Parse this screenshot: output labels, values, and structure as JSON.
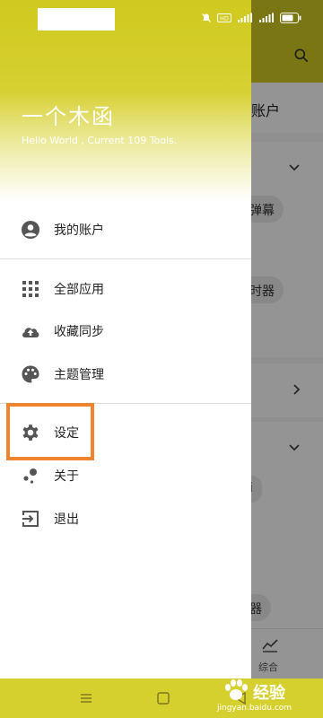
{
  "background_app": {
    "account_label": "账户",
    "chip_danmu": "弹幕",
    "chip_timer": "时器",
    "chip_lower1": "i",
    "chip_lower2": "器",
    "bottom_tab_label": "综合",
    "search_icon": "search-icon"
  },
  "drawer": {
    "title": "一个木函",
    "subtitle": "Hello World , Current 109 Tools.",
    "items": [
      {
        "label": "我的账户",
        "icon": "account-circle-icon"
      },
      {
        "label": "全部应用",
        "icon": "apps-grid-icon"
      },
      {
        "label": "收藏同步",
        "icon": "cloud-upload-icon"
      },
      {
        "label": "主题管理",
        "icon": "palette-icon"
      },
      {
        "label": "设定",
        "icon": "gear-icon"
      },
      {
        "label": "关于",
        "icon": "bubbles-icon"
      },
      {
        "label": "退出",
        "icon": "exit-icon"
      }
    ]
  },
  "highlighted_item": "设定",
  "watermark": {
    "text": "经验",
    "url": "jingyan.baidu.com"
  },
  "colors": {
    "accent": "#d6d02f",
    "highlight": "#f0852d"
  }
}
